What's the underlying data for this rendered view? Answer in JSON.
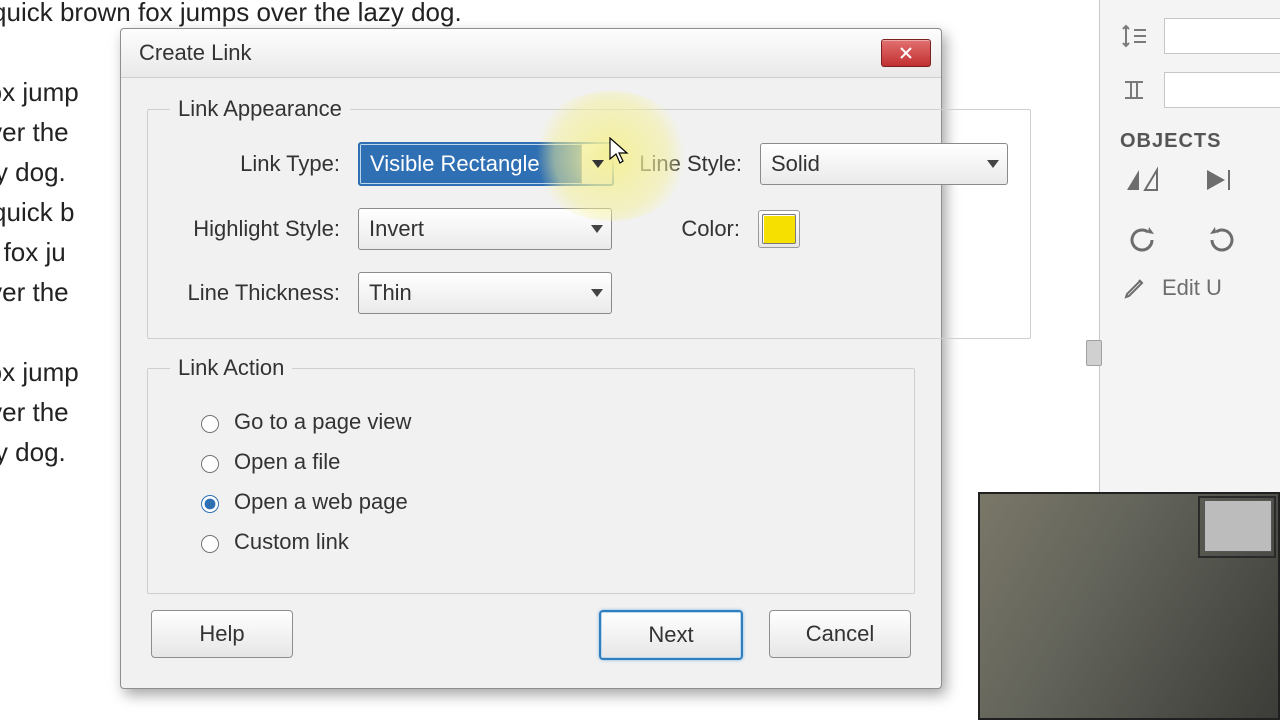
{
  "doc_lines": [
    "The quick brown fox jumps over the lazy dog.",
    "",
    "wn fox jump",
    "ps over the",
    "e lazy dog.",
    "The quick b",
    "rown fox ju",
    "ps over the",
    "",
    "wn fox jump",
    "ps over the",
    "e lazy dog."
  ],
  "dialog": {
    "title": "Create Link",
    "appearance": {
      "legend": "Link Appearance",
      "link_type_label": "Link Type:",
      "link_type_value": "Visible Rectangle",
      "line_style_label": "Line Style:",
      "line_style_value": "Solid",
      "highlight_label": "Highlight Style:",
      "highlight_value": "Invert",
      "color_label": "Color:",
      "color_value": "#f5e000",
      "thickness_label": "Line Thickness:",
      "thickness_value": "Thin"
    },
    "action": {
      "legend": "Link Action",
      "options": [
        "Go to a page view",
        "Open a file",
        "Open a web page",
        "Custom link"
      ],
      "selected": 2
    },
    "buttons": {
      "help": "Help",
      "next": "Next",
      "cancel": "Cancel"
    }
  },
  "sidepanel": {
    "objects_header": "OBJECTS",
    "edit_label": "Edit U"
  }
}
